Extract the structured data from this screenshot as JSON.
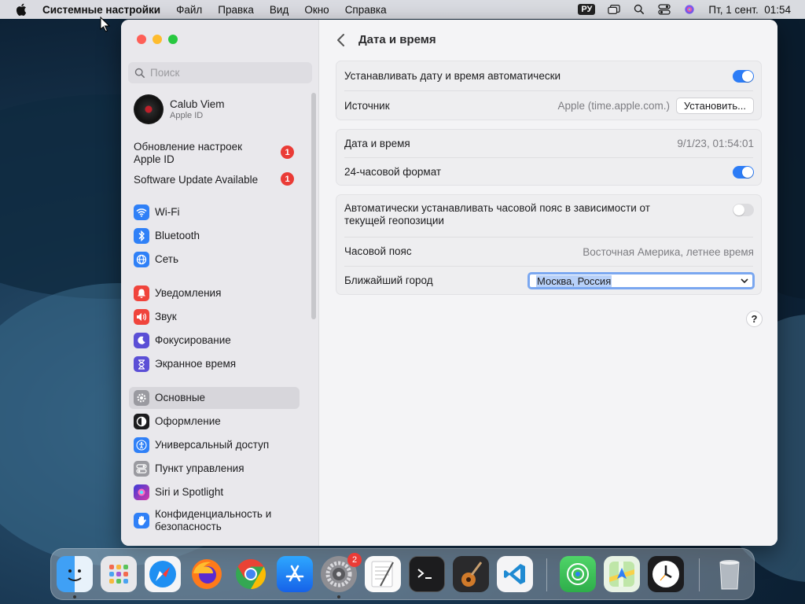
{
  "menubar": {
    "app_name": "Системные настройки",
    "items": [
      "Файл",
      "Правка",
      "Вид",
      "Окно",
      "Справка"
    ],
    "input_source": "РУ",
    "datetime": "Пт, 1 сент.  01:54"
  },
  "sidebar": {
    "search_placeholder": "Поиск",
    "profile": {
      "name": "Calub Viem",
      "subtitle": "Apple ID"
    },
    "notices": [
      {
        "label": "Обновление настроек Apple ID",
        "badge": "1"
      },
      {
        "label": "Software Update Available",
        "badge": "1"
      }
    ],
    "items": [
      {
        "label": "Wi-Fi",
        "icon": "wifi-icon"
      },
      {
        "label": "Bluetooth",
        "icon": "bluetooth-icon"
      },
      {
        "label": "Сеть",
        "icon": "globe-icon"
      },
      {
        "label": "Уведомления",
        "icon": "bell-icon"
      },
      {
        "label": "Звук",
        "icon": "speaker-icon"
      },
      {
        "label": "Фокусирование",
        "icon": "moon-icon"
      },
      {
        "label": "Экранное время",
        "icon": "hourglass-icon"
      },
      {
        "label": "Основные",
        "icon": "gear-icon"
      },
      {
        "label": "Оформление",
        "icon": "appearance-icon"
      },
      {
        "label": "Универсальный доступ",
        "icon": "accessibility-icon"
      },
      {
        "label": "Пункт управления",
        "icon": "control-center-icon"
      },
      {
        "label": "Siri и Spotlight",
        "icon": "siri-icon"
      },
      {
        "label": "Конфиденциальность и безопасность",
        "icon": "hand-icon"
      }
    ],
    "active_item": "Основные"
  },
  "content": {
    "title": "Дата и время",
    "groups": [
      {
        "rows": [
          {
            "label": "Устанавливать дату и время автоматически",
            "toggle": true
          },
          {
            "label": "Источник",
            "value": "Apple (time.apple.com.)",
            "button": "Установить..."
          }
        ]
      },
      {
        "rows": [
          {
            "label": "Дата и время",
            "value": "9/1/23, 01:54:01"
          },
          {
            "label": "24-часовой формат",
            "toggle": true
          }
        ]
      },
      {
        "rows": [
          {
            "label": "Автоматически устанавливать часовой пояс в зависимости от текущей геопозиции",
            "toggle": false
          },
          {
            "label": "Часовой пояс",
            "value": "Восточная Америка, летнее время"
          },
          {
            "label": "Ближайший город",
            "select": "Москва, Россия"
          }
        ]
      }
    ],
    "help": "?"
  },
  "dock": {
    "apps": [
      "Finder",
      "Launchpad",
      "Safari",
      "Firefox",
      "Chrome",
      "App Store",
      "Системные настройки",
      "TextEdit",
      "Terminal",
      "GarageBand",
      "Visual Studio Code",
      "Find My",
      "Maps",
      "Clock",
      "Trash"
    ],
    "settings_badge": "2"
  },
  "colors": {
    "accent": "#2c7cf6",
    "badge": "#ea3b36"
  }
}
